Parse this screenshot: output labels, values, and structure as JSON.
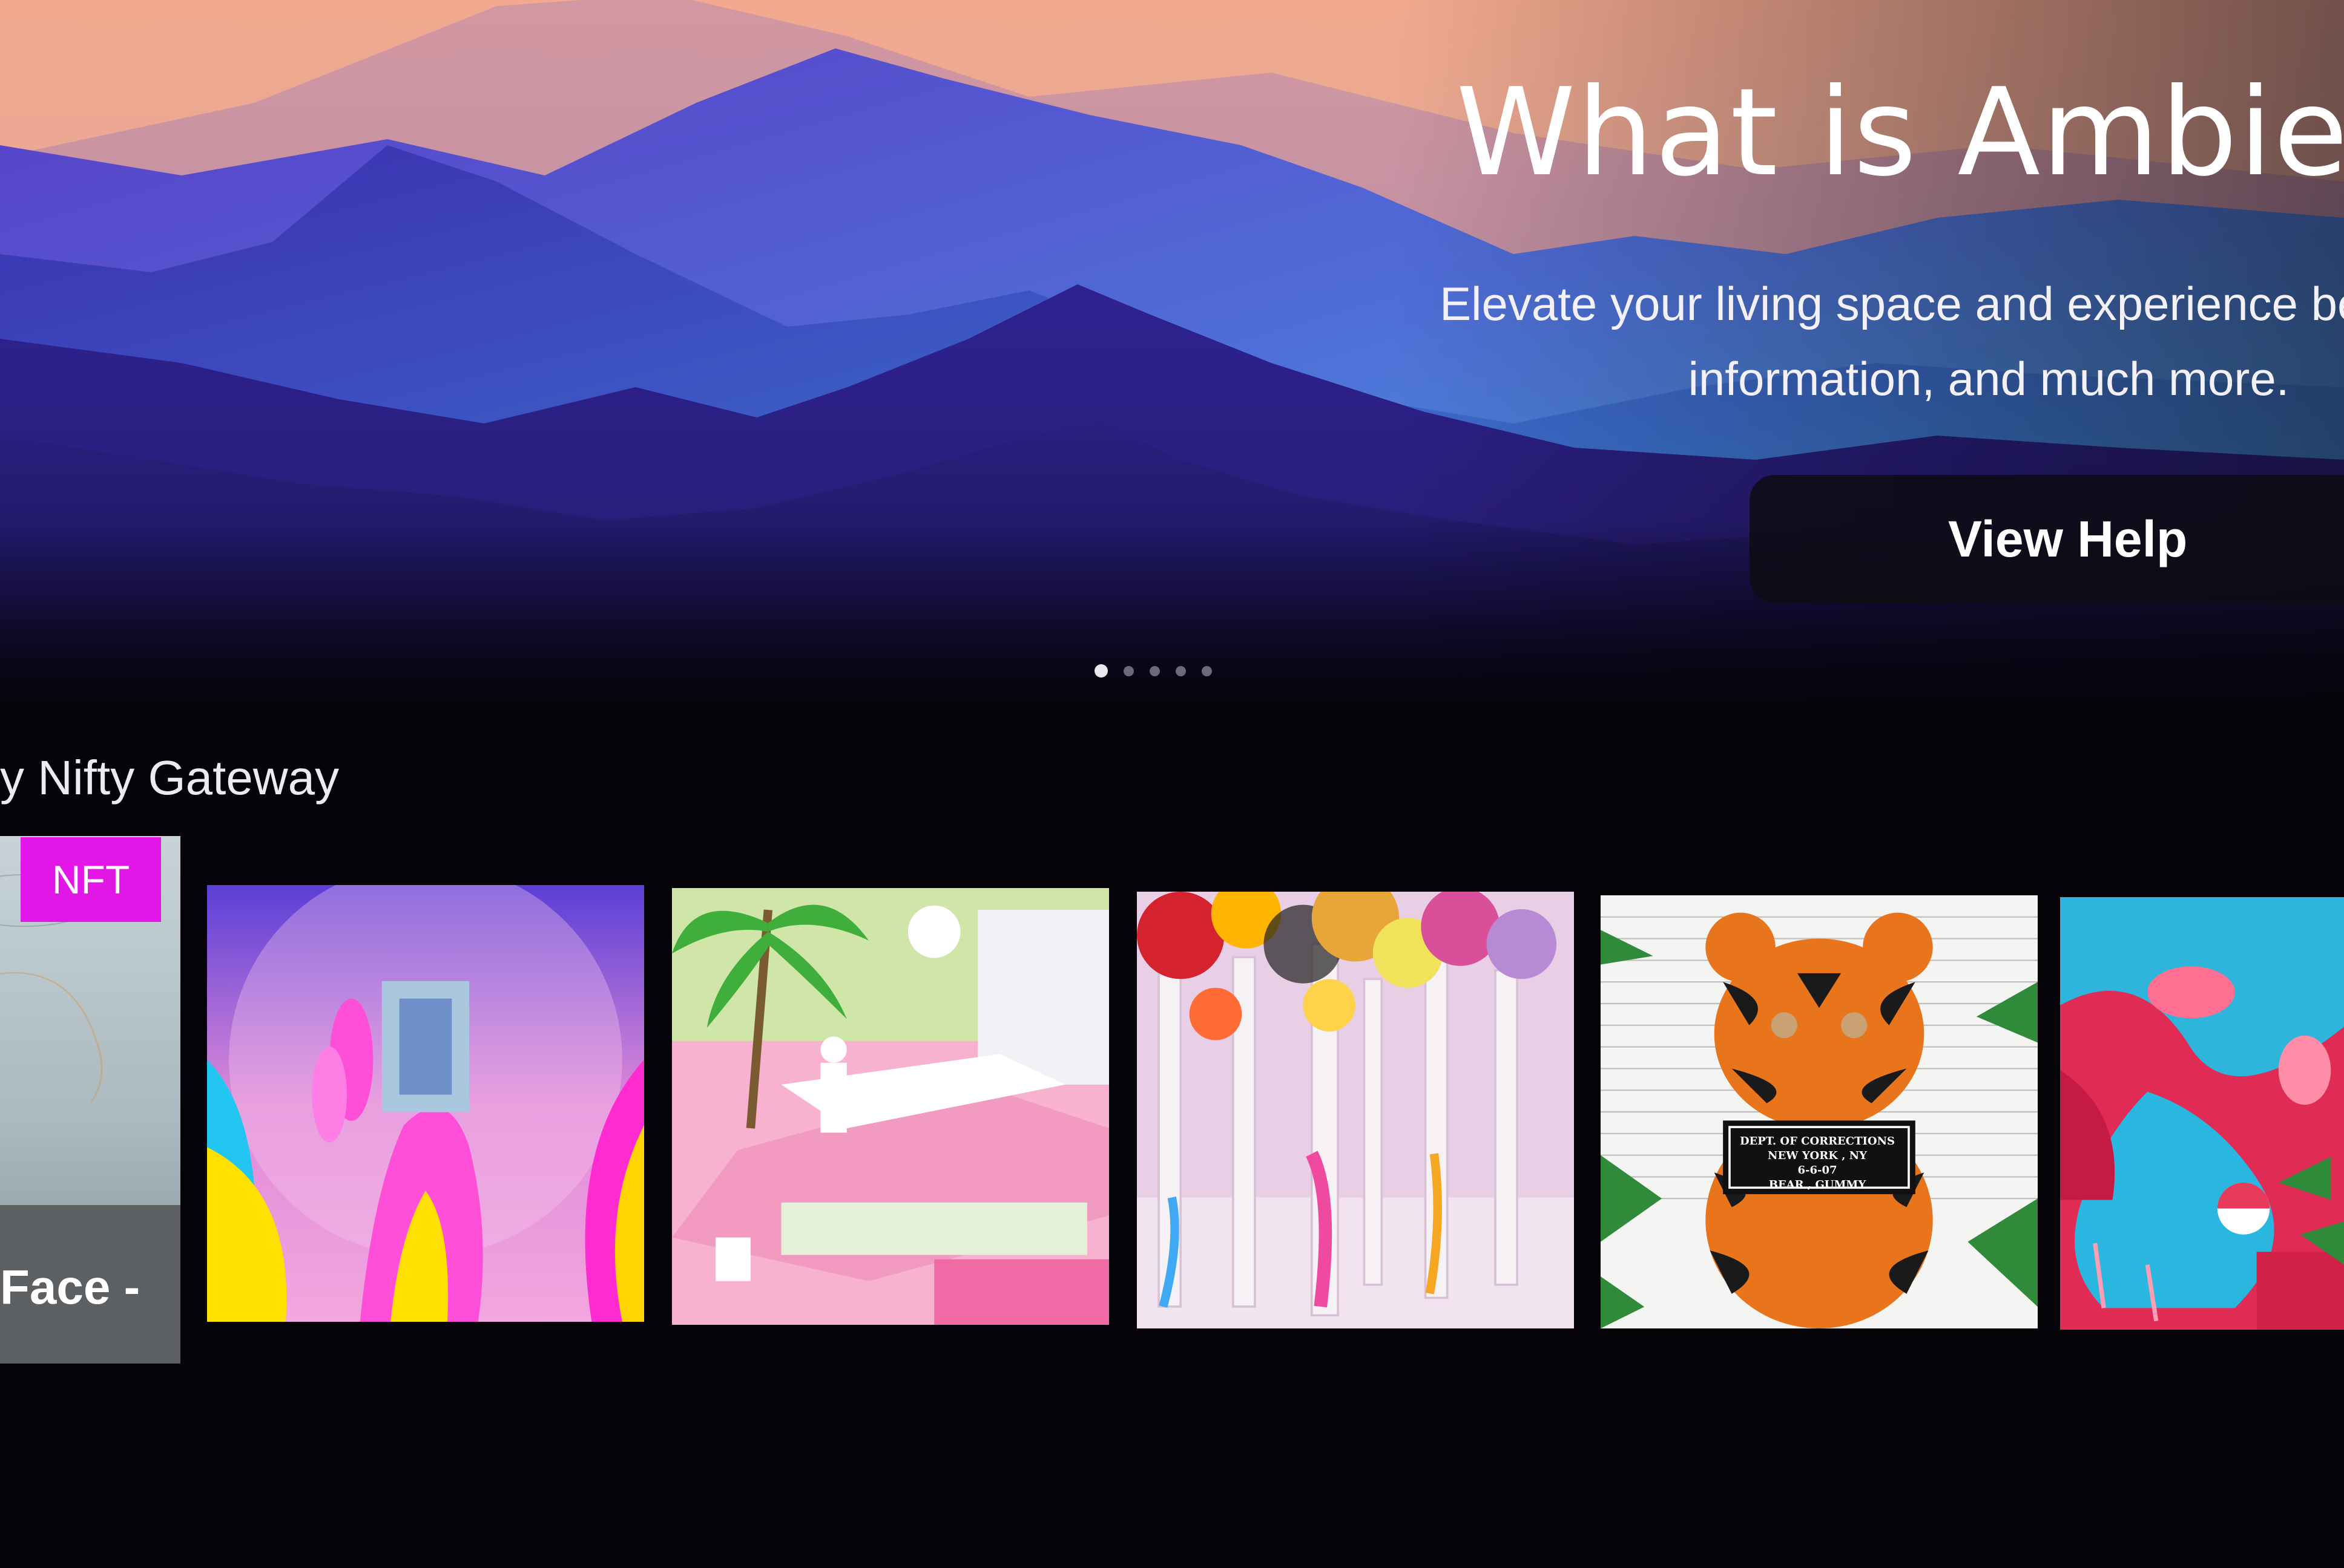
{
  "hero": {
    "title": "What is Ambient M",
    "description_line1": "Elevate your living space and experience beautif",
    "description_line2": "information, and much more.",
    "button_label": "View Help",
    "carousel": {
      "total": 5,
      "active_index": 0
    }
  },
  "section": {
    "title": "y Nifty Gateway",
    "first_item": {
      "badge": "NFT",
      "caption": "Face -"
    }
  },
  "artworks": [
    {
      "subject": "neon-hand-art"
    },
    {
      "subject": "pink-flamingo-garden-art"
    },
    {
      "subject": "painted-trees-art"
    },
    {
      "subject": "tiger-gummy-bear-mugshot-art",
      "sign_lines": [
        "DEPT. OF CORRECTIONS",
        "NEW YORK , NY",
        "6-6-07",
        "BEAR , GUMMY"
      ]
    },
    {
      "subject": "flamingo-pool-art"
    }
  ],
  "colors": {
    "badge": "#e316e8",
    "background": "#050308",
    "button_bg": "#0e0c14"
  }
}
